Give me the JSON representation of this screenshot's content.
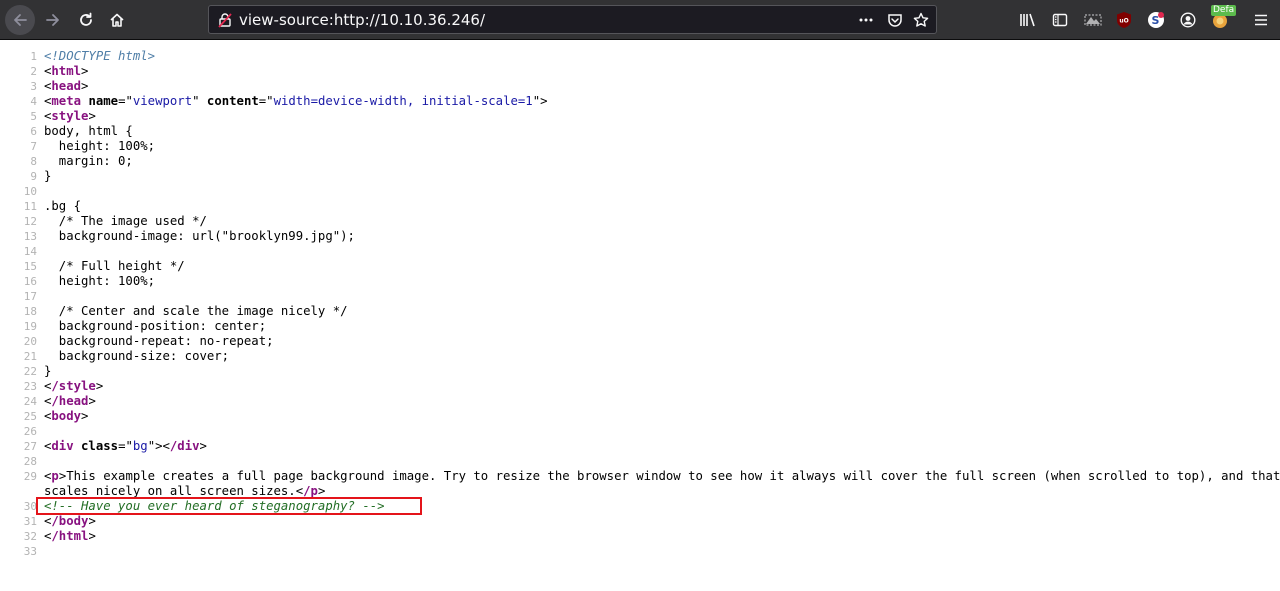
{
  "browser": {
    "url": "view-source:http://10.10.36.246/",
    "extension_badge": "Defa",
    "icons": [
      "back-icon",
      "forward-icon",
      "reload-icon",
      "home-icon",
      "lock-icon",
      "page-actions-icon",
      "pocket-icon",
      "bookmark-star-icon",
      "library-icon",
      "sidebar-icon",
      "screenshot-icon",
      "ublock-icon",
      "extension-s-icon",
      "account-icon",
      "extension-default-icon",
      "menu-icon"
    ]
  },
  "source": {
    "lines": [
      {
        "n": "1",
        "html": "<span class=\"doctype\">&lt;!DOCTYPE html&gt;</span>"
      },
      {
        "n": "2",
        "html": "<span class=\"tag\"><span class=\"punc\">&lt;</span>html<span class=\"punc\">&gt;</span></span>"
      },
      {
        "n": "3",
        "html": "<span class=\"tag\"><span class=\"punc\">&lt;</span>head<span class=\"punc\">&gt;</span></span>"
      },
      {
        "n": "4",
        "html": "<span class=\"tag\"><span class=\"punc\">&lt;</span>meta</span> <span class=\"attr\">name</span>=\"<span class=\"val\">viewport</span>\" <span class=\"attr\">content</span>=\"<span class=\"val\">width=device-width, initial-scale=1</span>\"<span class=\"punc\">&gt;</span>"
      },
      {
        "n": "5",
        "html": "<span class=\"tag\"><span class=\"punc\">&lt;</span>style<span class=\"punc\">&gt;</span></span>"
      },
      {
        "n": "6",
        "html": "body, html {"
      },
      {
        "n": "7",
        "html": "  height: 100%;"
      },
      {
        "n": "8",
        "html": "  margin: 0;"
      },
      {
        "n": "9",
        "html": "}"
      },
      {
        "n": "10",
        "html": ""
      },
      {
        "n": "11",
        "html": ".bg {"
      },
      {
        "n": "12",
        "html": "  /* The image used */"
      },
      {
        "n": "13",
        "html": "  background-image: url(\"brooklyn99.jpg\");"
      },
      {
        "n": "14",
        "html": ""
      },
      {
        "n": "15",
        "html": "  /* Full height */"
      },
      {
        "n": "16",
        "html": "  height: 100%;"
      },
      {
        "n": "17",
        "html": ""
      },
      {
        "n": "18",
        "html": "  /* Center and scale the image nicely */"
      },
      {
        "n": "19",
        "html": "  background-position: center;"
      },
      {
        "n": "20",
        "html": "  background-repeat: no-repeat;"
      },
      {
        "n": "21",
        "html": "  background-size: cover;"
      },
      {
        "n": "22",
        "html": "}"
      },
      {
        "n": "23",
        "html": "<span class=\"tag\"><span class=\"punc\">&lt;</span>/style<span class=\"punc\">&gt;</span></span>"
      },
      {
        "n": "24",
        "html": "<span class=\"tag\"><span class=\"punc\">&lt;</span>/head<span class=\"punc\">&gt;</span></span>"
      },
      {
        "n": "25",
        "html": "<span class=\"tag\"><span class=\"punc\">&lt;</span>body<span class=\"punc\">&gt;</span></span>"
      },
      {
        "n": "26",
        "html": ""
      },
      {
        "n": "27",
        "html": "<span class=\"tag\"><span class=\"punc\">&lt;</span>div</span> <span class=\"attr\">class</span>=\"<span class=\"val\">bg</span>\"<span class=\"punc\">&gt;</span><span class=\"tag\"><span class=\"punc\">&lt;</span>/div<span class=\"punc\">&gt;</span></span>"
      },
      {
        "n": "28",
        "html": ""
      },
      {
        "n": "29",
        "html": "<span class=\"tag\"><span class=\"punc\">&lt;</span>p<span class=\"punc\">&gt;</span></span>This example creates a full page background image. Try to resize the browser window to see how it always will cover the full screen (when scrolled to top), and that it"
      },
      {
        "n": "",
        "html": "scales nicely on all screen sizes.<span class=\"tag\"><span class=\"punc\">&lt;</span>/p<span class=\"punc\">&gt;</span></span>"
      },
      {
        "n": "30",
        "html": "<span class=\"cmt\">&lt;!-- Have you ever heard of steganography? --&gt;</span>"
      },
      {
        "n": "31",
        "html": "<span class=\"tag\"><span class=\"punc\">&lt;</span>/body<span class=\"punc\">&gt;</span></span>"
      },
      {
        "n": "32",
        "html": "<span class=\"tag\"><span class=\"punc\">&lt;</span>/html<span class=\"punc\">&gt;</span></span>"
      },
      {
        "n": "33",
        "html": ""
      }
    ]
  },
  "colors": {
    "toolbar_bg": "#323234",
    "urlbar_bg": "#1c1b22",
    "tag": "#881280",
    "attr_value": "#1a1aa6",
    "comment": "#236e25",
    "highlight_box": "#e4141a"
  }
}
